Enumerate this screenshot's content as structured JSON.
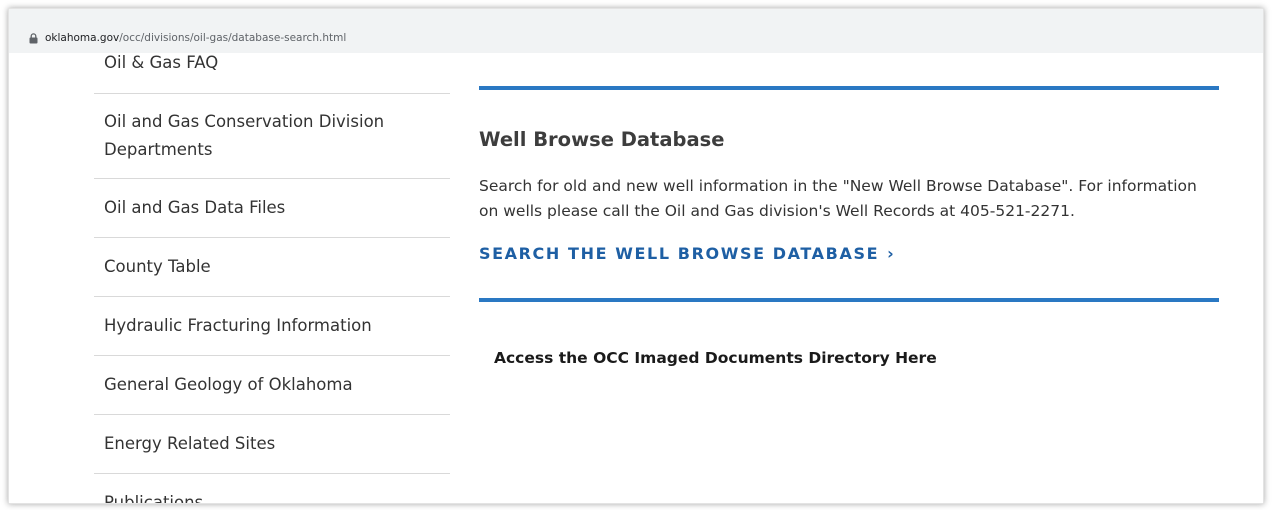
{
  "browser": {
    "url_host": "oklahoma.gov",
    "url_path": "/occ/divisions/oil-gas/database-search.html"
  },
  "sidebar": {
    "items": [
      {
        "label": "Oil & Gas FAQ"
      },
      {
        "label": "Oil and Gas Conservation Division Departments"
      },
      {
        "label": "Oil and Gas Data Files"
      },
      {
        "label": "County Table"
      },
      {
        "label": "Hydraulic Fracturing Information"
      },
      {
        "label": "General Geology of Oklahoma"
      },
      {
        "label": "Energy Related Sites"
      },
      {
        "label": "Publications"
      }
    ]
  },
  "main": {
    "title": "Well Browse Database",
    "description": "Search for old and new well information in the \"New Well Browse Database\". For information on wells please call the Oil and Gas division's Well Records at 405-521-2271.",
    "cta_label": "SEARCH THE WELL BROWSE DATABASE",
    "cta_icon": "chevron-right-icon",
    "access_link": "Access the OCC Imaged Documents Directory Here"
  },
  "colors": {
    "accent_rule": "#2a78c3",
    "link": "#1e5fa4"
  }
}
